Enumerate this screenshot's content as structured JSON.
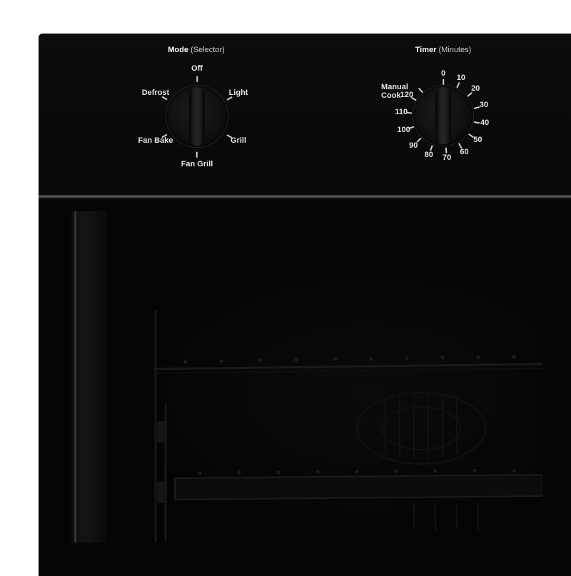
{
  "mode_knob": {
    "title_bold": "Mode",
    "title_light": "(Selector)",
    "positions": [
      "Off",
      "Light",
      "Grill",
      "Fan Grill",
      "Fan Bake",
      "Defrost"
    ]
  },
  "timer_knob": {
    "title_bold": "Timer",
    "title_light": "(Minutes)",
    "positions": [
      "0",
      "10",
      "20",
      "30",
      "40",
      "50",
      "60",
      "70",
      "80",
      "90",
      "100",
      "110",
      "120",
      "Manual Cook"
    ]
  },
  "colors": {
    "oven_body": "#070707",
    "label_text": "#e6e6e6",
    "background": "#ffffff"
  }
}
